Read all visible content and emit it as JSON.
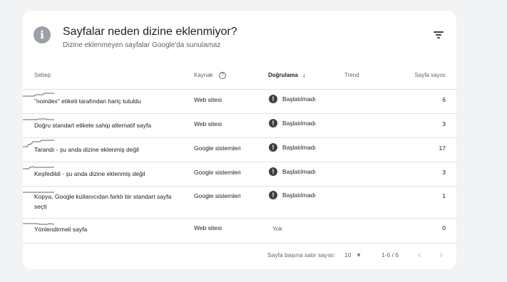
{
  "header": {
    "title": "Sayfalar neden dizine eklenmiyor?",
    "subtitle": "Dizine eklenmeyen sayfalar Google'da sunulamaz",
    "info_icon": "i"
  },
  "columns": {
    "sebep": "Sebep",
    "kaynak": "Kaynak",
    "help_icon": "?",
    "dogrulama": "Doğrulama",
    "sort_icon": "↓",
    "trend": "Trend",
    "count": "Sayfa sayısı"
  },
  "rows": [
    {
      "sebep": "\"noindex\" etiketi tarafından hariç tutuldu",
      "kaynak": "Web sitesi",
      "dogrulama": "Başlatılmadı",
      "status_icon": "!",
      "count": "6"
    },
    {
      "sebep": "Doğru standart etikete sahip alternatif sayfa",
      "kaynak": "Web sitesi",
      "dogrulama": "Başlatılmadı",
      "status_icon": "!",
      "count": "3"
    },
    {
      "sebep": "Tarandı - şu anda dizine eklenmiş değil",
      "kaynak": "Google sistemleri",
      "dogrulama": "Başlatılmadı",
      "status_icon": "!",
      "count": "17"
    },
    {
      "sebep": "Keşfedildi - şu anda dizine eklenmiş değil",
      "kaynak": "Google sistemleri",
      "dogrulama": "Başlatılmadı",
      "status_icon": "!",
      "count": "3"
    },
    {
      "sebep": "Kopya, Google kullanıcıdan farklı bir standart sayfa seçti",
      "kaynak": "Google sistemleri",
      "dogrulama": "Başlatılmadı",
      "status_icon": "!",
      "count": "1"
    },
    {
      "sebep": "Yönlendirmeli sayfa",
      "kaynak": "Web sitesi",
      "dogrulama": "Yok",
      "count": "0"
    }
  ],
  "trend_icon": "sparkline",
  "footer": {
    "rows_per_page_label": "Sayfa başına satır sayısı:",
    "rows_per_page_value": "10",
    "dropdown_icon": "▾",
    "range": "1-6 / 6",
    "prev_icon": "‹",
    "next_icon": "›"
  },
  "colors": {
    "background": "#f1f3f4",
    "card": "#ffffff",
    "status_icon": "#3c4043",
    "trend_line": "#5f6368"
  }
}
